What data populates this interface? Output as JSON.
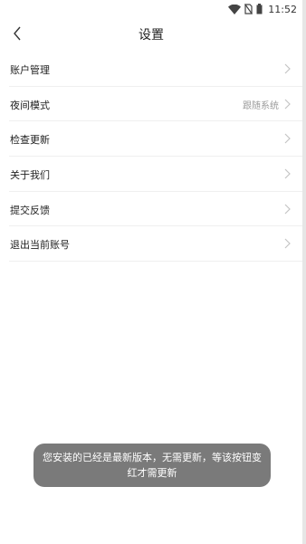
{
  "status_bar": {
    "time": "11:52"
  },
  "header": {
    "title": "设置"
  },
  "settings": [
    {
      "label": "账户管理",
      "value": ""
    },
    {
      "label": "夜间模式",
      "value": "跟随系统"
    },
    {
      "label": "检查更新",
      "value": ""
    },
    {
      "label": "关于我们",
      "value": ""
    },
    {
      "label": "提交反馈",
      "value": ""
    },
    {
      "label": "退出当前账号",
      "value": ""
    }
  ],
  "toast": {
    "message": "您安装的已经是最新版本，无需更新，等该按钮变红才需更新"
  },
  "colors": {
    "toast_bg": "#7a7a7a",
    "divider": "#efefef",
    "secondary_text": "#9a9a9a"
  },
  "icons": [
    "wifi-icon",
    "no-sim-icon",
    "battery-icon",
    "back-arrow-icon",
    "chevron-right-icon"
  ]
}
